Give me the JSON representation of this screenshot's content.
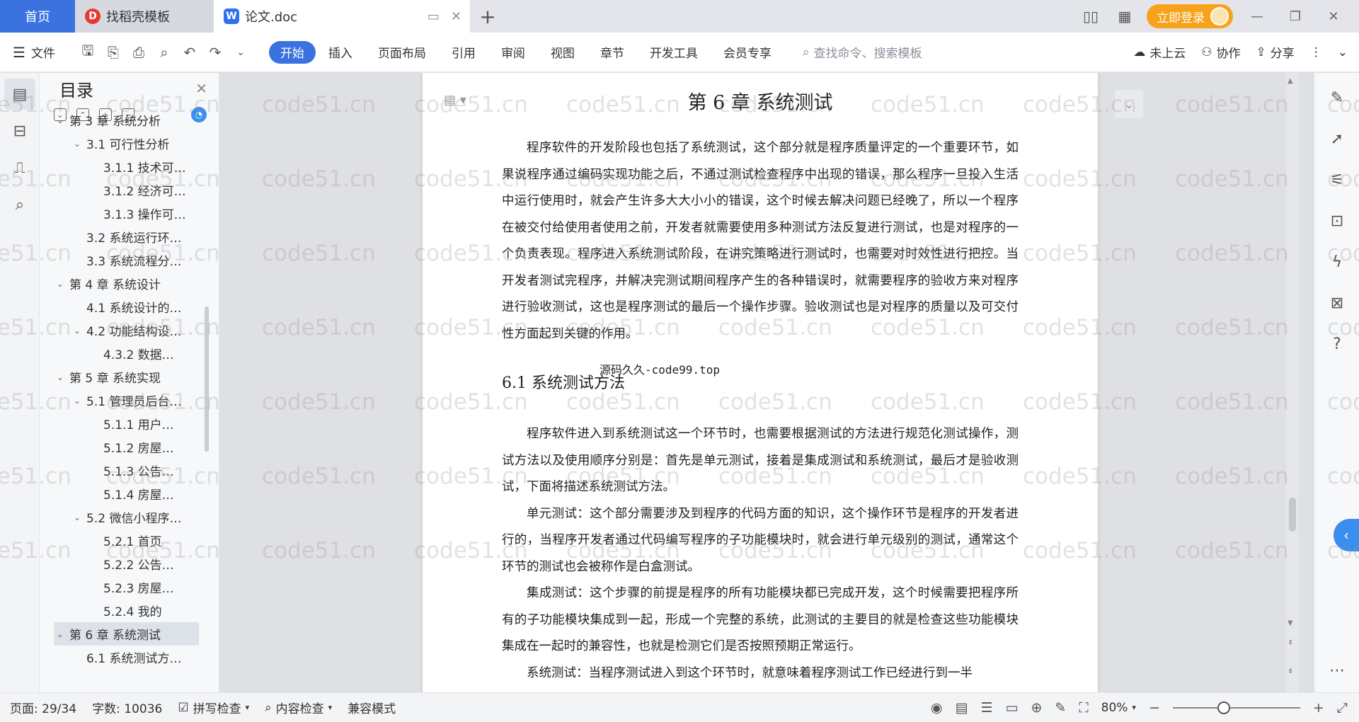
{
  "tabs": {
    "home": "首页",
    "tab2": "找稻壳模板",
    "tab3": "论文.doc",
    "login": "立即登录"
  },
  "toolbar": {
    "file": "文件",
    "menu": [
      "开始",
      "插入",
      "页面布局",
      "引用",
      "审阅",
      "视图",
      "章节",
      "开发工具",
      "会员专享"
    ],
    "search": "查找命令、搜索模板",
    "cloud": "未上云",
    "collab": "协作",
    "share": "分享"
  },
  "toc": {
    "title": "目录",
    "items": [
      {
        "label": "第 3 章  系统分析",
        "level": 0,
        "caret": "⌄"
      },
      {
        "label": "3.1 可行性分析",
        "level": 1,
        "caret": "⌄"
      },
      {
        "label": "3.1.1 技术可…",
        "level": 2,
        "caret": ""
      },
      {
        "label": "3.1.2 经济可…",
        "level": 2,
        "caret": ""
      },
      {
        "label": "3.1.3 操作可…",
        "level": 2,
        "caret": ""
      },
      {
        "label": "3.2 系统运行环…",
        "level": 1,
        "caret": ""
      },
      {
        "label": "3.3 系统流程分…",
        "level": 1,
        "caret": ""
      },
      {
        "label": "第 4 章  系统设计",
        "level": 0,
        "caret": "⌄"
      },
      {
        "label": "4.1  系统设计的…",
        "level": 1,
        "caret": ""
      },
      {
        "label": "4.2  功能结构设…",
        "level": 1,
        "caret": "⌄"
      },
      {
        "label": "4.3.2  数据…",
        "level": 2,
        "caret": ""
      },
      {
        "label": "第 5 章  系统实现",
        "level": 0,
        "caret": "⌄"
      },
      {
        "label": "5.1 管理员后台…",
        "level": 1,
        "caret": "⌄"
      },
      {
        "label": "5.1.1  用户…",
        "level": 2,
        "caret": ""
      },
      {
        "label": "5.1.2  房屋…",
        "level": 2,
        "caret": ""
      },
      {
        "label": "5.1.3  公告…",
        "level": 2,
        "caret": ""
      },
      {
        "label": "5.1.4  房屋…",
        "level": 2,
        "caret": ""
      },
      {
        "label": "5.2  微信小程序…",
        "level": 1,
        "caret": "⌄"
      },
      {
        "label": "5.2.1  首页",
        "level": 2,
        "caret": ""
      },
      {
        "label": "5.2.2  公告…",
        "level": 2,
        "caret": ""
      },
      {
        "label": "5.2.3  房屋…",
        "level": 2,
        "caret": ""
      },
      {
        "label": "5.2.4  我的",
        "level": 2,
        "caret": ""
      },
      {
        "label": "第 6 章  系统测试",
        "level": 0,
        "caret": "⌄",
        "selected": true
      },
      {
        "label": "6.1 系统测试方…",
        "level": 1,
        "caret": ""
      }
    ]
  },
  "doc": {
    "chapter_title": "第 6 章  系统测试",
    "para1": "程序软件的开发阶段也包括了系统测试，这个部分就是程序质量评定的一个重要环节，如果说程序通过编码实现功能之后，不通过测试检查程序中出现的错误，那么程序一旦投入生活中运行使用时，就会产生许多大大小小的错误，这个时候去解决问题已经晚了，所以一个程序在被交付给使用者使用之前，开发者就需要使用多种测试方法反复进行测试，也是对程序的一个负责表现。程序进入系统测试阶段，在讲究策略进行测试时，也需要对时效性进行把控。当开发者测试完程序，并解决完测试期间程序产生的各种错误时，就需要程序的验收方来对程序进行验收测试，这也是程序测试的最后一个操作步骤。验收测试也是对程序的质量以及可交付性方面起到关键的作用。",
    "source_note": "源码久久-code99.top",
    "section_title": "6.1 系统测试方法",
    "para2": "程序软件进入到系统测试这一个环节时，也需要根据测试的方法进行规范化测试操作，测试方法以及使用顺序分别是：首先是单元测试，接着是集成测试和系统测试，最后才是验收测试，下面将描述系统测试方法。",
    "para3": "单元测试：这个部分需要涉及到程序的代码方面的知识，这个操作环节是程序的开发者进行的，当程序开发者通过代码编写程序的子功能模块时，就会进行单元级别的测试，通常这个环节的测试也会被称作是白盒测试。",
    "para4": "集成测试：这个步骤的前提是程序的所有功能模块都已完成开发，这个时候需要把程序所有的子功能模块集成到一起，形成一个完整的系统，此测试的主要目的就是检查这些功能模块集成在一起时的兼容性，也就是检测它们是否按照预期正常运行。",
    "para5": "系统测试：当程序测试进入到这个环节时，就意味着程序测试工作已经进行到一半"
  },
  "watermark": "code51.cn",
  "status": {
    "page": "页面: 29/34",
    "words": "字数: 10036",
    "spell": "拼写检查",
    "content": "内容检查",
    "compat": "兼容模式",
    "zoom": "80%",
    "zoom_level": 0.4
  },
  "colors": {
    "accent": "#3a73e0",
    "login": "#f7a21b"
  }
}
